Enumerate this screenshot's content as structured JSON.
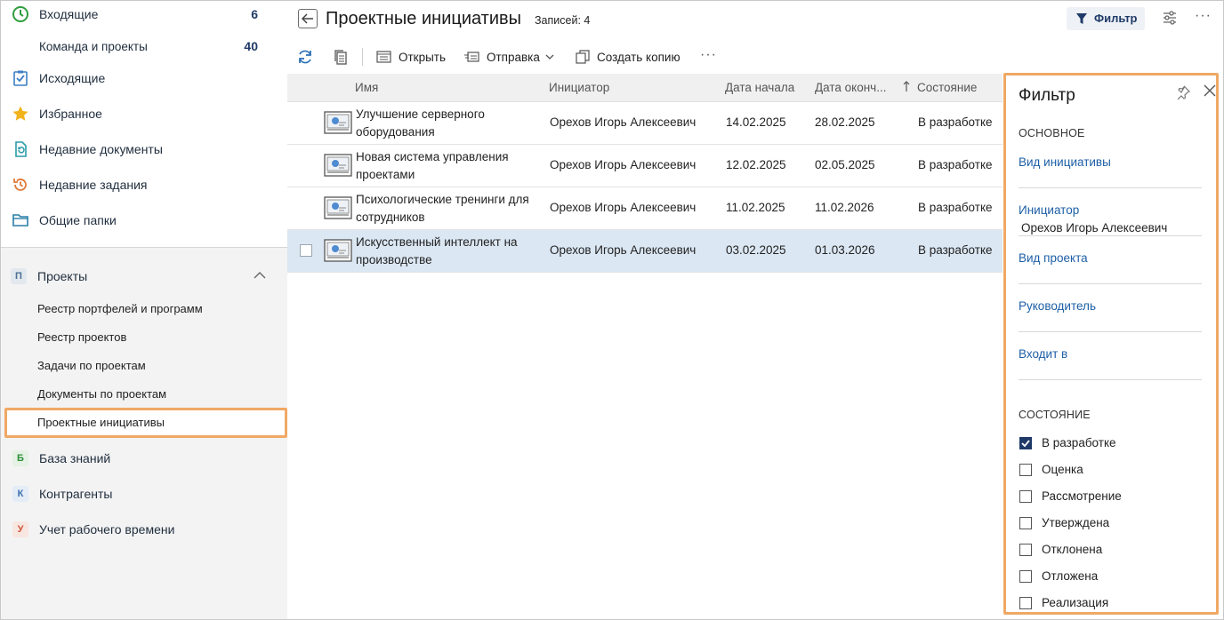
{
  "sidebar": {
    "top_items": [
      {
        "label": "Входящие",
        "count": "6",
        "icon": "clock-icon"
      },
      {
        "label": "Команда и проекты",
        "count": "40"
      },
      {
        "label": "Исходящие",
        "icon": "outbox-check-icon"
      },
      {
        "label": "Избранное",
        "icon": "star-icon"
      },
      {
        "label": "Недавние документы",
        "icon": "recent-doc-icon"
      },
      {
        "label": "Недавние задания",
        "icon": "recent-task-icon"
      },
      {
        "label": "Общие папки",
        "icon": "folder-icon"
      }
    ],
    "projects": {
      "badge": "П",
      "label": "Проекты",
      "items": [
        "Реестр портфелей и программ",
        "Реестр проектов",
        "Задачи по проектам",
        "Документы по проектам",
        "Проектные инициативы"
      ]
    },
    "bottom_items": [
      {
        "badge": "Б",
        "label": "База знаний",
        "color": "#2f8f3a",
        "bg": "#e4f1e4"
      },
      {
        "badge": "К",
        "label": "Контрагенты",
        "color": "#3d6fb0",
        "bg": "#e4ecf6"
      },
      {
        "badge": "У",
        "label": "Учет рабочего времени",
        "color": "#d0553a",
        "bg": "#f8e6e1"
      }
    ]
  },
  "header": {
    "title": "Проектные инициативы",
    "records": "Записей: 4",
    "filter_label": "Фильтр"
  },
  "toolbar": {
    "open_label": "Открыть",
    "send_label": "Отправка",
    "copy_label": "Создать копию"
  },
  "grid": {
    "columns": [
      "Имя",
      "Инициатор",
      "Дата начала",
      "Дата оконч...",
      "Состояние"
    ],
    "rows": [
      {
        "name": "Улучшение серверного оборудования",
        "initiator": "Орехов Игорь Алексеевич",
        "start": "14.02.2025",
        "end": "28.02.2025",
        "state": "В разработке"
      },
      {
        "name": "Новая система управления проектами",
        "initiator": "Орехов Игорь Алексеевич",
        "start": "12.02.2025",
        "end": "02.05.2025",
        "state": "В разработке"
      },
      {
        "name": "Психологические тренинги для сотрудников",
        "initiator": "Орехов Игорь Алексеевич",
        "start": "11.02.2025",
        "end": "11.02.2026",
        "state": "В разработке"
      },
      {
        "name": "Искусственный интеллект на производстве",
        "initiator": "Орехов Игорь Алексеевич",
        "start": "03.02.2025",
        "end": "01.03.2026",
        "state": "В разработке"
      }
    ]
  },
  "filter_panel": {
    "title": "Фильтр",
    "section_main": "ОСНОВНОЕ",
    "type_label": "Вид инициативы",
    "initiator_label": "Инициатор",
    "initiator_value": "Орехов Игорь Алексеевич",
    "project_type_label": "Вид проекта",
    "manager_label": "Руководитель",
    "part_of_label": "Входит в",
    "section_state": "СОСТОЯНИЕ",
    "states": [
      {
        "label": "В разработке",
        "checked": true
      },
      {
        "label": "Оценка",
        "checked": false
      },
      {
        "label": "Рассмотрение",
        "checked": false
      },
      {
        "label": "Утверждена",
        "checked": false
      },
      {
        "label": "Отклонена",
        "checked": false
      },
      {
        "label": "Отложена",
        "checked": false
      },
      {
        "label": "Реализация",
        "checked": false
      }
    ]
  }
}
